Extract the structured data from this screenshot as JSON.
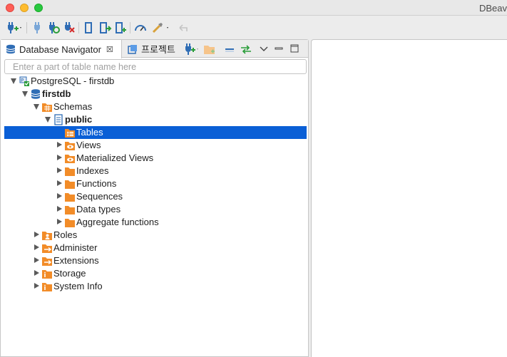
{
  "window": {
    "title": "DBeav"
  },
  "toolbar": {
    "items": [
      "new-connection-icon",
      "dropdown-arrow-icon",
      "connect-icon",
      "reconnect-icon",
      "disconnect-icon",
      "commit-icon",
      "rollback-icon",
      "transaction-icon",
      "dashboard-icon",
      "tools-icon",
      "dropdown-arrow-icon",
      "back-icon"
    ]
  },
  "navigator": {
    "tab_active_label": "Database Navigator",
    "tab_project_label": "프로젝트",
    "filter_placeholder": "Enter a part of table name here"
  },
  "tree": [
    {
      "label": "PostgreSQL - firstdb",
      "icon": "postgresql-icon",
      "expanded": true,
      "depth": 0,
      "bold": false,
      "selected": false
    },
    {
      "label": "firstdb",
      "icon": "database-icon",
      "expanded": true,
      "depth": 1,
      "bold": true,
      "selected": false
    },
    {
      "label": "Schemas",
      "icon": "schemas-folder-icon",
      "expanded": true,
      "depth": 2,
      "bold": false,
      "selected": false
    },
    {
      "label": "public",
      "icon": "schema-icon",
      "expanded": true,
      "depth": 3,
      "bold": true,
      "selected": false
    },
    {
      "label": "Tables",
      "icon": "tables-folder-icon",
      "expanded": null,
      "depth": 4,
      "bold": false,
      "selected": true
    },
    {
      "label": "Views",
      "icon": "views-folder-icon",
      "expanded": false,
      "depth": 4,
      "bold": false,
      "selected": false
    },
    {
      "label": "Materialized Views",
      "icon": "materialized-views-folder-icon",
      "expanded": false,
      "depth": 4,
      "bold": false,
      "selected": false
    },
    {
      "label": "Indexes",
      "icon": "folder-icon",
      "expanded": false,
      "depth": 4,
      "bold": false,
      "selected": false
    },
    {
      "label": "Functions",
      "icon": "folder-icon",
      "expanded": false,
      "depth": 4,
      "bold": false,
      "selected": false
    },
    {
      "label": "Sequences",
      "icon": "folder-icon",
      "expanded": false,
      "depth": 4,
      "bold": false,
      "selected": false
    },
    {
      "label": "Data types",
      "icon": "folder-icon",
      "expanded": false,
      "depth": 4,
      "bold": false,
      "selected": false
    },
    {
      "label": "Aggregate functions",
      "icon": "folder-icon",
      "expanded": false,
      "depth": 4,
      "bold": false,
      "selected": false
    },
    {
      "label": "Roles",
      "icon": "roles-folder-icon",
      "expanded": false,
      "depth": 2,
      "bold": false,
      "selected": false
    },
    {
      "label": "Administer",
      "icon": "administer-folder-icon",
      "expanded": false,
      "depth": 2,
      "bold": false,
      "selected": false
    },
    {
      "label": "Extensions",
      "icon": "extensions-folder-icon",
      "expanded": false,
      "depth": 2,
      "bold": false,
      "selected": false
    },
    {
      "label": "Storage",
      "icon": "storage-folder-icon",
      "expanded": false,
      "depth": 2,
      "bold": false,
      "selected": false
    },
    {
      "label": "System Info",
      "icon": "system-info-folder-icon",
      "expanded": false,
      "depth": 2,
      "bold": false,
      "selected": false
    }
  ],
  "colors": {
    "selection": "#0a5fd6",
    "folder": "#f28c28",
    "db": "#2b6cb0"
  }
}
